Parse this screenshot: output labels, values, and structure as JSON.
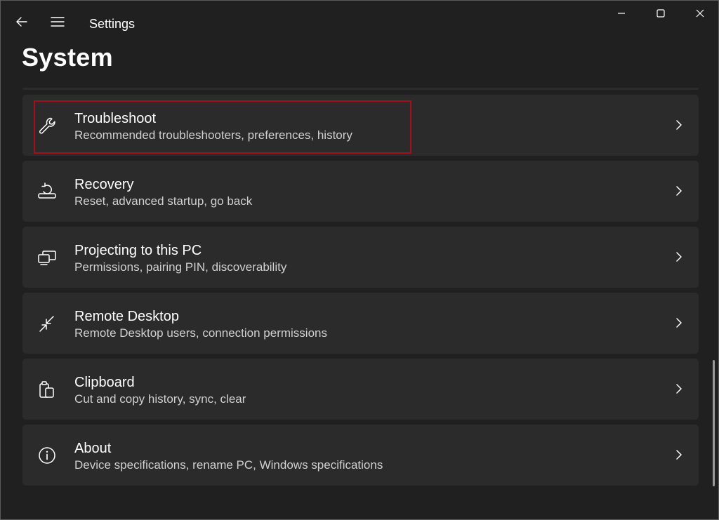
{
  "app": {
    "title": "Settings"
  },
  "page": {
    "title": "System"
  },
  "items": [
    {
      "id": "troubleshoot",
      "title": "Troubleshoot",
      "subtitle": "Recommended troubleshooters, preferences, history",
      "icon": "wrench-icon",
      "highlighted": true
    },
    {
      "id": "recovery",
      "title": "Recovery",
      "subtitle": "Reset, advanced startup, go back",
      "icon": "recovery-icon",
      "highlighted": false
    },
    {
      "id": "projecting",
      "title": "Projecting to this PC",
      "subtitle": "Permissions, pairing PIN, discoverability",
      "icon": "projecting-icon",
      "highlighted": false
    },
    {
      "id": "remote-desktop",
      "title": "Remote Desktop",
      "subtitle": "Remote Desktop users, connection permissions",
      "icon": "remote-desktop-icon",
      "highlighted": false
    },
    {
      "id": "clipboard",
      "title": "Clipboard",
      "subtitle": "Cut and copy history, sync, clear",
      "icon": "clipboard-icon",
      "highlighted": false
    },
    {
      "id": "about",
      "title": "About",
      "subtitle": "Device specifications, rename PC, Windows specifications",
      "icon": "info-icon",
      "highlighted": false
    }
  ],
  "colors": {
    "background": "#202020",
    "card": "#2b2b2b",
    "highlight_border": "#a3101c",
    "text": "#ffffff",
    "subtext": "#d0d0d0"
  }
}
